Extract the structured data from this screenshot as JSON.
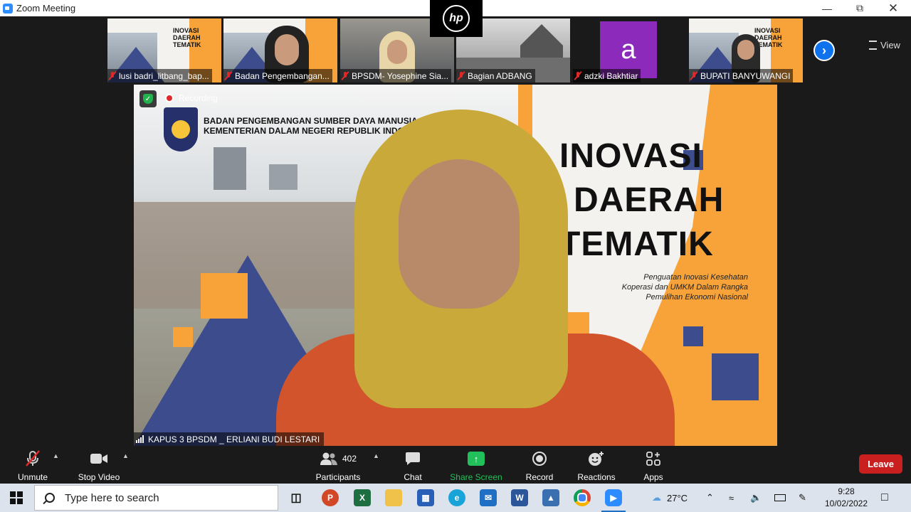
{
  "window": {
    "title": "Zoom Meeting"
  },
  "strip": {
    "participants": [
      {
        "name": "lusi badri_litbang_bap..."
      },
      {
        "name": "Badan Pengembangan..."
      },
      {
        "name": "BPSDM- Yosephine Sia..."
      },
      {
        "name": "Bagian ADBANG"
      },
      {
        "name": "adzki Bakhtiar",
        "avatar_letter": "a"
      },
      {
        "name": "BUPATI BANYUWANGI"
      }
    ],
    "thumb_slide_title": "INOVASI DAERAH TEMATIK",
    "view_label": "View",
    "next_icon": "chevron-right-icon"
  },
  "overlay": {
    "hp_logo": "hp"
  },
  "main": {
    "recording_label": "Recording",
    "org_line1": "BADAN PENGEMBANGAN SUMBER DAYA MANUSIA",
    "org_line2": "KEMENTERIAN DALAM NEGERI REPUBLIK INDONE",
    "slide_title_1": "INOVASI",
    "slide_title_2": "DAERAH",
    "slide_title_3": "TEMATIK",
    "slide_sub_1": "Penguatan Inovasi Kesehatan",
    "slide_sub_2": "Koperasi dan UMKM Dalam Rangka",
    "slide_sub_3": "Pemulihan Ekonomi Nasional",
    "speaker_name": "KAPUS 3 BPSDM _ ERLIANI BUDI LESTARI"
  },
  "toolbar": {
    "unmute": "Unmute",
    "stop_video": "Stop Video",
    "participants_count": "402",
    "participants": "Participants",
    "chat": "Chat",
    "share_screen": "Share Screen",
    "record": "Record",
    "reactions": "Reactions",
    "apps": "Apps",
    "leave": "Leave"
  },
  "taskbar": {
    "search_placeholder": "Type here to search",
    "weather": "27°C",
    "time": "9:28",
    "date": "10/02/2022"
  },
  "colors": {
    "zoom_blue": "#0e72ed",
    "leave_red": "#c91f1f",
    "share_green": "#22c05a",
    "slide_orange": "#f7a33a",
    "slide_navy": "#3c4c8c"
  }
}
